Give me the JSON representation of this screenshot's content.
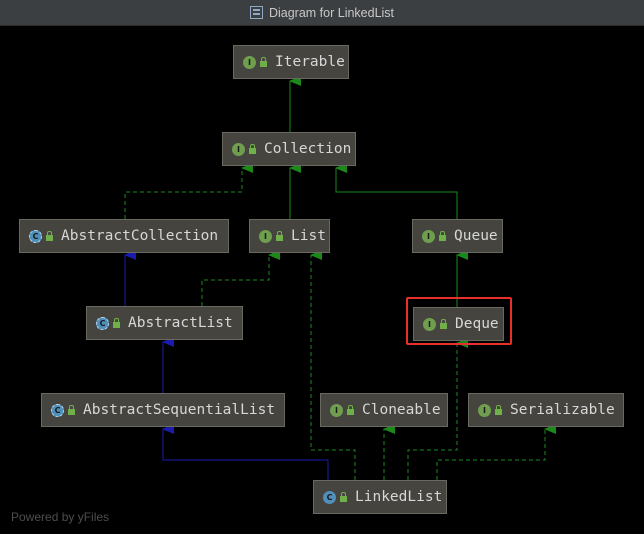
{
  "window": {
    "title": "Diagram for LinkedList",
    "icon": "class-diagram-icon"
  },
  "colors": {
    "background": "#000000",
    "node_fill": "#45443f",
    "implements_edge": "#1b8a1b",
    "extends_edge": "#1b1bb0",
    "highlight": "#e8302a"
  },
  "nodes": [
    {
      "id": "iterable",
      "label": "Iterable",
      "kind": "interface"
    },
    {
      "id": "collection",
      "label": "Collection",
      "kind": "interface"
    },
    {
      "id": "abstractcollection",
      "label": "AbstractCollection",
      "kind": "abstract-class"
    },
    {
      "id": "list",
      "label": "List",
      "kind": "interface"
    },
    {
      "id": "queue",
      "label": "Queue",
      "kind": "interface"
    },
    {
      "id": "abstractlist",
      "label": "AbstractList",
      "kind": "abstract-class"
    },
    {
      "id": "deque",
      "label": "Deque",
      "kind": "interface",
      "highlighted": true
    },
    {
      "id": "abstractsequentiallist",
      "label": "AbstractSequentialList",
      "kind": "abstract-class"
    },
    {
      "id": "cloneable",
      "label": "Cloneable",
      "kind": "interface"
    },
    {
      "id": "serializable",
      "label": "Serializable",
      "kind": "interface"
    },
    {
      "id": "linkedlist",
      "label": "LinkedList",
      "kind": "class"
    }
  ],
  "edges": [
    {
      "from": "collection",
      "to": "iterable",
      "type": "extends-interface"
    },
    {
      "from": "abstractcollection",
      "to": "collection",
      "type": "implements"
    },
    {
      "from": "list",
      "to": "collection",
      "type": "extends-interface"
    },
    {
      "from": "queue",
      "to": "collection",
      "type": "extends-interface"
    },
    {
      "from": "abstractlist",
      "to": "abstractcollection",
      "type": "extends-class"
    },
    {
      "from": "abstractlist",
      "to": "list",
      "type": "implements"
    },
    {
      "from": "deque",
      "to": "queue",
      "type": "extends-interface"
    },
    {
      "from": "abstractsequentiallist",
      "to": "abstractlist",
      "type": "extends-class"
    },
    {
      "from": "linkedlist",
      "to": "abstractsequentiallist",
      "type": "extends-class"
    },
    {
      "from": "linkedlist",
      "to": "list",
      "type": "implements"
    },
    {
      "from": "linkedlist",
      "to": "cloneable",
      "type": "implements"
    },
    {
      "from": "linkedlist",
      "to": "deque",
      "type": "implements"
    },
    {
      "from": "linkedlist",
      "to": "serializable",
      "type": "implements"
    }
  ],
  "footer": "Powered by yFiles"
}
